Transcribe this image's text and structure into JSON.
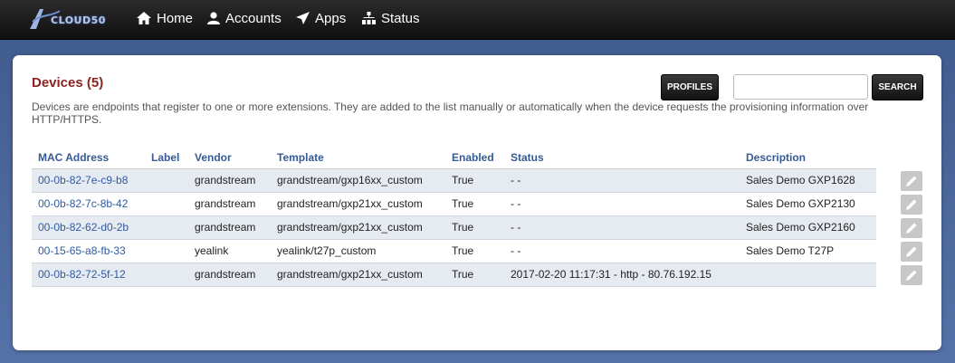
{
  "brand": {
    "logo_text": "CLOUD50"
  },
  "nav": [
    {
      "label": "Home",
      "icon": "home-icon"
    },
    {
      "label": "Accounts",
      "icon": "user-icon"
    },
    {
      "label": "Apps",
      "icon": "send-icon"
    },
    {
      "label": "Status",
      "icon": "sitemap-icon"
    }
  ],
  "page": {
    "title": "Devices (5)",
    "description": "Devices are endpoints that register to one or more extensions. They are added to the list manually or automatically when the device requests the provisioning information over HTTP/HTTPS.",
    "profiles_button": "PROFILES",
    "search_button": "SEARCH",
    "search_value": ""
  },
  "table": {
    "headers": [
      "MAC Address",
      "Label",
      "Vendor",
      "Template",
      "Enabled",
      "Status",
      "Description"
    ],
    "rows": [
      {
        "mac": "00-0b-82-7e-c9-b8",
        "label": "",
        "vendor": "grandstream",
        "template": "grandstream/gxp16xx_custom",
        "enabled": "True",
        "status": "- -",
        "description": "Sales Demo GXP1628"
      },
      {
        "mac": "00-0b-82-7c-8b-42",
        "label": "",
        "vendor": "grandstream",
        "template": "grandstream/gxp21xx_custom",
        "enabled": "True",
        "status": "- -",
        "description": "Sales Demo GXP2130"
      },
      {
        "mac": "00-0b-82-62-d0-2b",
        "label": "",
        "vendor": "grandstream",
        "template": "grandstream/gxp21xx_custom",
        "enabled": "True",
        "status": "- -",
        "description": "Sales Demo GXP2160"
      },
      {
        "mac": "00-15-65-a8-fb-33",
        "label": "",
        "vendor": "yealink",
        "template": "yealink/t27p_custom",
        "enabled": "True",
        "status": "- -",
        "description": "Sales Demo T27P"
      },
      {
        "mac": "00-0b-82-72-5f-12",
        "label": "",
        "vendor": "grandstream",
        "template": "grandstream/gxp21xx_custom",
        "enabled": "True",
        "status": "2017-02-20 11:17:31 - http - 80.76.192.15",
        "description": ""
      }
    ]
  },
  "colors": {
    "title": "#8b2323",
    "link": "#2f5aa3",
    "row_alt": "#e6eaf1",
    "background": "#4a67a0"
  }
}
